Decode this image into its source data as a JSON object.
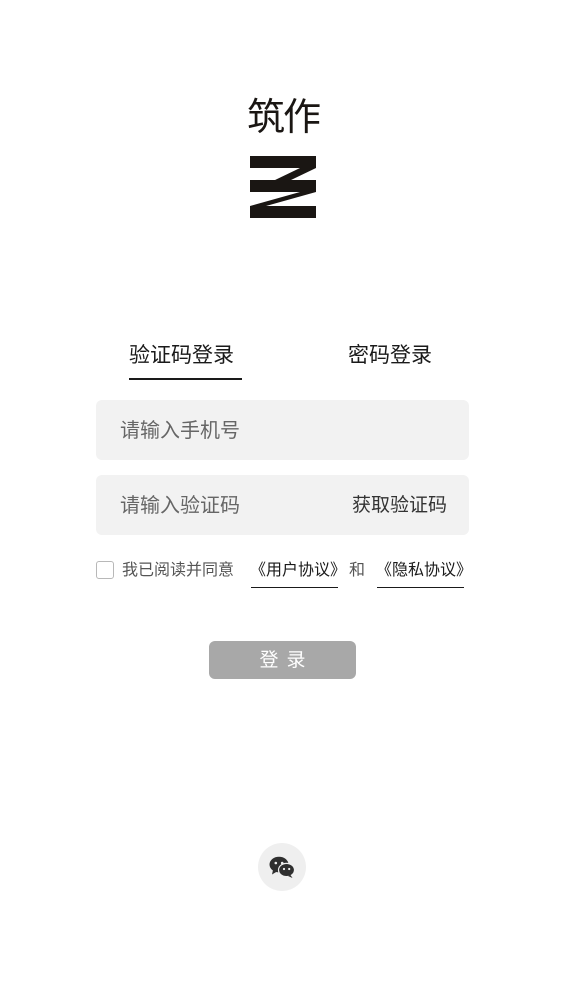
{
  "logo": {
    "text": "筑作",
    "mark": "logo-mark-z-icon"
  },
  "tabs": [
    {
      "label": "验证码登录",
      "active": true
    },
    {
      "label": "密码登录",
      "active": false
    }
  ],
  "phone_input": {
    "placeholder": "请输入手机号",
    "value": ""
  },
  "code_input": {
    "placeholder": "请输入验证码",
    "value": ""
  },
  "get_code_label": "获取验证码",
  "agreement": {
    "checked": false,
    "prefix": "我已阅读并同意",
    "user_link": "《用户协议》",
    "conjunction": "和",
    "privacy_link": "《隐私协议》"
  },
  "login_button": {
    "label": "登录",
    "enabled": false,
    "color": "#a8a8a8"
  },
  "social_login": {
    "icon": "wechat-icon"
  }
}
